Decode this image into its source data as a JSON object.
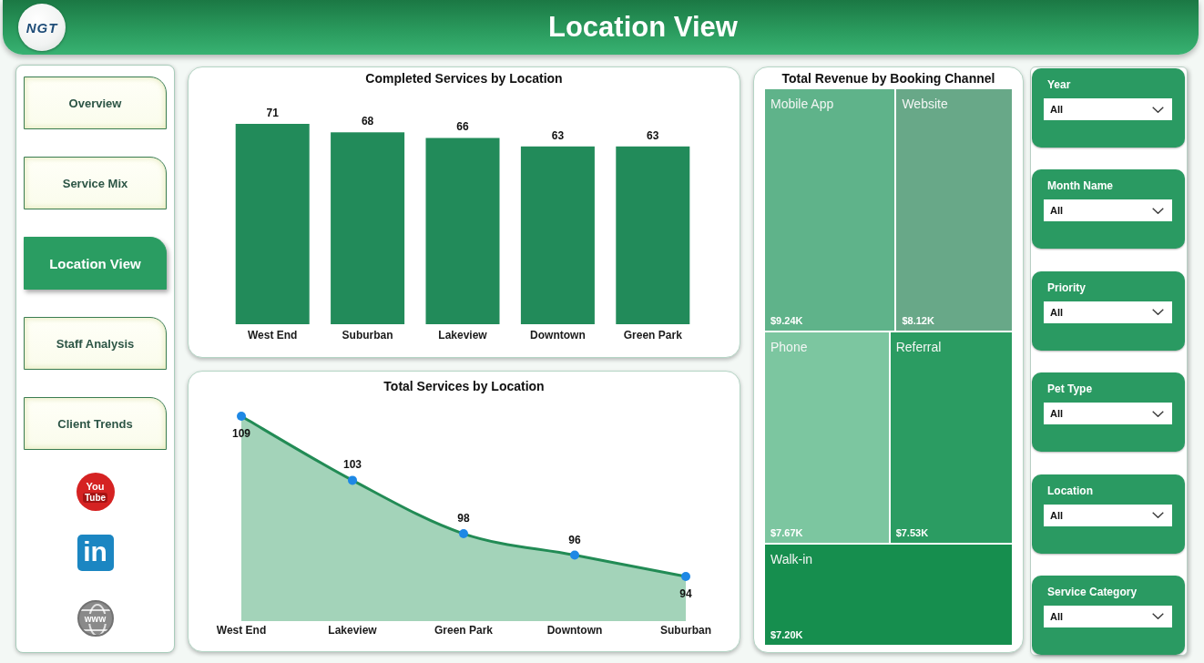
{
  "header": {
    "logo_text": "NGT",
    "title": "Location View"
  },
  "nav": {
    "items": [
      {
        "label": "Overview",
        "selected": false
      },
      {
        "label": "Service Mix",
        "selected": false
      },
      {
        "label": "Location View",
        "selected": true
      },
      {
        "label": "Staff Analysis",
        "selected": false
      },
      {
        "label": "Client Trends",
        "selected": false
      }
    ],
    "social_links": [
      {
        "kind": "youtube",
        "lines": [
          "You",
          "Tube"
        ]
      },
      {
        "kind": "linkedin",
        "lines": [
          "in"
        ]
      },
      {
        "kind": "website",
        "lines": [
          "www"
        ]
      }
    ]
  },
  "completed_services": {
    "chart_data": {
      "type": "bar",
      "title": "Completed Services by Location",
      "categories": [
        "West End",
        "Suburban",
        "Lakeview",
        "Downtown",
        "Green Park"
      ],
      "values": [
        71,
        68,
        66,
        63,
        63
      ],
      "data_labels": true
    }
  },
  "total_services": {
    "chart_data": {
      "type": "area",
      "title": "Total Services by Location",
      "categories": [
        "West End",
        "Lakeview",
        "Green Park",
        "Downtown",
        "Suburban"
      ],
      "values": [
        109,
        103,
        98,
        96,
        94
      ],
      "data_labels": true
    }
  },
  "revenue_by_channel": {
    "title": "Total Revenue by Booking Channel",
    "tiles": [
      {
        "name": "Mobile App",
        "value": "$9.24K",
        "color": "#5fb38a"
      },
      {
        "name": "Website",
        "value": "$8.12K",
        "color": "#68a888"
      },
      {
        "name": "Phone",
        "value": "$7.67K",
        "color": "#7cc6a0"
      },
      {
        "name": "Referral",
        "value": "$7.53K",
        "color": "#2b9c62"
      },
      {
        "name": "Walk-in",
        "value": "$7.20K",
        "color": "#168e4e"
      }
    ]
  },
  "filters": [
    {
      "label": "Year",
      "value": "All"
    },
    {
      "label": "Month Name",
      "value": "All"
    },
    {
      "label": "Priority",
      "value": "All"
    },
    {
      "label": "Pet Type",
      "value": "All"
    },
    {
      "label": "Location",
      "value": "All"
    },
    {
      "label": "Service Category",
      "value": "All"
    }
  ]
}
